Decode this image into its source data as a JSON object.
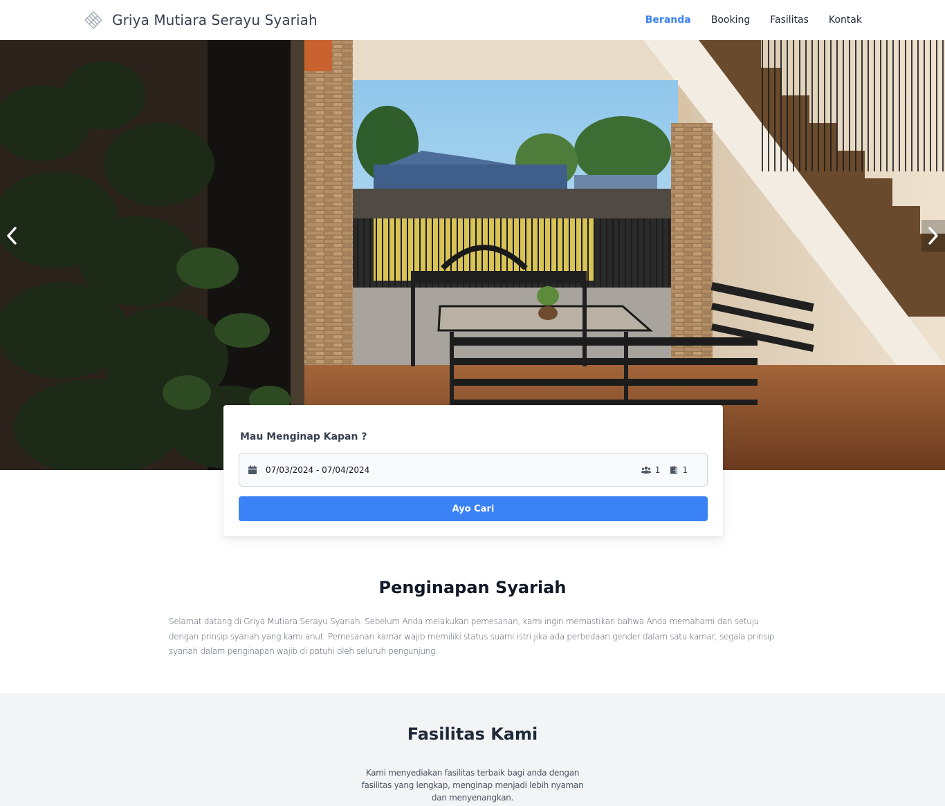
{
  "brand": {
    "name": "Griya Mutiara Serayu Syariah",
    "logo_icon": "diamond-logo-icon"
  },
  "nav": {
    "items": [
      {
        "label": "Beranda",
        "active": true
      },
      {
        "label": "Booking",
        "active": false
      },
      {
        "label": "Fasilitas",
        "active": false
      },
      {
        "label": "Kontak",
        "active": false
      }
    ],
    "active_color": "#3b82f6"
  },
  "hero": {
    "prev_icon": "chevron-left-icon",
    "next_icon": "chevron-right-icon"
  },
  "search": {
    "title": "Mau Menginap Kapan ?",
    "date_range": "07/03/2024 - 07/04/2024",
    "guests": "1",
    "rooms": "1",
    "button_label": "Ayo Cari",
    "button_color": "#3b82f6"
  },
  "about": {
    "title": "Penginapan Syariah",
    "text": "Selamat datang di Griya Mutiara Serayu Syariah. Sebelum Anda melakukan pemesanan, kami ingin memastikan bahwa Anda memahami dan setuju dengan prinsip syariah yang kami anut. Pemesanan kamar wajib memiliki status suami istri jika ada perbedaan gender dalam satu kamar, segala prinsip syariah dalam penginapan wajib di patuhi oleh seluruh pengunjung."
  },
  "facilities": {
    "title": "Fasilitas Kami",
    "text": "Kami menyediakan fasilitas terbaik bagi anda dengan fasilitas yang lengkap, menginap menjadi lebih nyaman dan menyenangkan."
  }
}
